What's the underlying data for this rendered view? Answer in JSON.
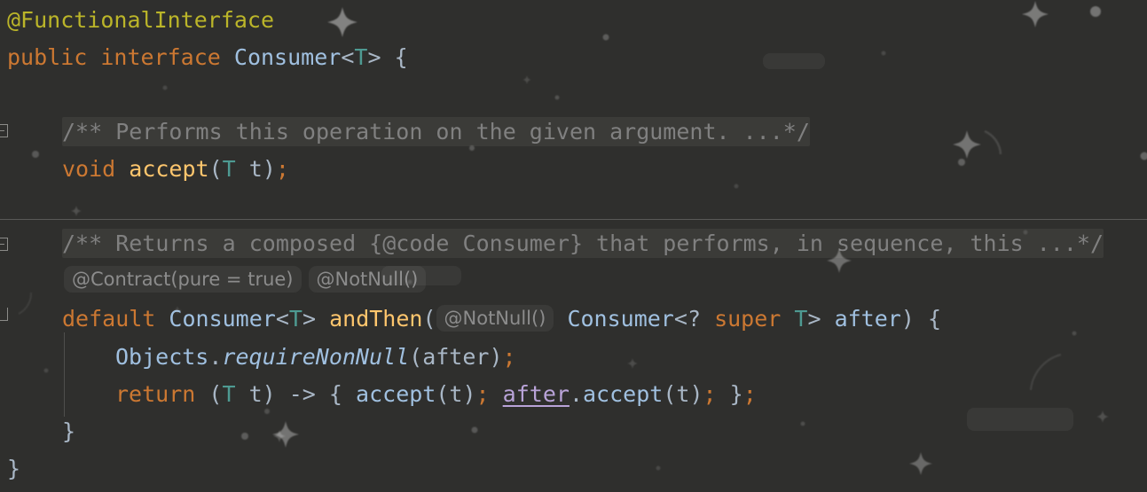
{
  "app": {
    "kind": "code-editor-snippet",
    "language": "Java",
    "theme": "darcula",
    "background_color": "#2f2f2d"
  },
  "colors": {
    "annotation": "#bbb529",
    "keyword": "#cc7832",
    "class_name": "#a0c0e0",
    "type_param": "#4e9a92",
    "method_name": "#ffc66d",
    "identifier": "#a9b7c6",
    "comment_folded": "#808080",
    "folded_background": "#3b3b38",
    "inlay_hint_text": "#8c8c8c",
    "inlay_hint_background": "#3a3a38",
    "captured_variable": "#b9a3d8",
    "separator": "#5a5a58",
    "indent_guide": "#4f4f4d",
    "gutter_icon": "#8b8b88"
  },
  "code": {
    "lines": [
      {
        "id": "line-annotation",
        "text": "@FunctionalInterface",
        "tokens": [
          {
            "t": "@FunctionalInterface",
            "c": "tok-anno"
          }
        ]
      },
      {
        "id": "line-interface-decl",
        "text": "public interface Consumer<T> {",
        "tokens": [
          {
            "t": "public",
            "c": "tok-kw"
          },
          {
            "t": " ",
            "c": "tok-punct"
          },
          {
            "t": "interface",
            "c": "tok-kw"
          },
          {
            "t": " ",
            "c": "tok-punct"
          },
          {
            "t": "Consumer",
            "c": "tok-cls"
          },
          {
            "t": "<",
            "c": "tok-punct"
          },
          {
            "t": "T",
            "c": "tok-type"
          },
          {
            "t": ">",
            "c": "tok-punct"
          },
          {
            "t": " ",
            "c": "tok-punct"
          },
          {
            "t": "{",
            "c": "tok-brace"
          }
        ]
      },
      {
        "id": "line-javadoc-accept",
        "text": "/** Performs this operation on the given argument. ...*/",
        "folded": true,
        "tokens": [
          {
            "t": "/** Performs this operation on the given argument. ...*/",
            "c": "folded"
          }
        ]
      },
      {
        "id": "line-accept",
        "text": "void accept(T t);",
        "tokens": [
          {
            "t": "void",
            "c": "tok-kw"
          },
          {
            "t": " ",
            "c": "tok-punct"
          },
          {
            "t": "accept",
            "c": "tok-method"
          },
          {
            "t": "(",
            "c": "tok-punct"
          },
          {
            "t": "T",
            "c": "tok-type"
          },
          {
            "t": " ",
            "c": "tok-punct"
          },
          {
            "t": "t",
            "c": "tok-ident"
          },
          {
            "t": ")",
            "c": "tok-punct"
          },
          {
            "t": ";",
            "c": "tok-semi"
          }
        ]
      },
      {
        "id": "line-javadoc-andthen",
        "text": "/** Returns a composed {@code Consumer} that performs, in sequence, this ...*/",
        "folded": true,
        "tokens": [
          {
            "t": "/** Returns a composed {@code Consumer} that performs, in sequence, this ...*/",
            "c": "folded"
          }
        ]
      },
      {
        "id": "line-andthen-decl",
        "text": "default Consumer<T> andThen( @NotNull() Consumer<? super T> after) {",
        "tokens": [
          {
            "t": "default",
            "c": "tok-kw"
          },
          {
            "t": " ",
            "c": "tok-punct"
          },
          {
            "t": "Consumer",
            "c": "tok-cls"
          },
          {
            "t": "<",
            "c": "tok-punct"
          },
          {
            "t": "T",
            "c": "tok-type"
          },
          {
            "t": ">",
            "c": "tok-punct"
          },
          {
            "t": " ",
            "c": "tok-punct"
          },
          {
            "t": "andThen",
            "c": "tok-method"
          },
          {
            "t": "(",
            "c": "tok-punct"
          },
          {
            "t": "@NotNull()",
            "c": "inlay"
          },
          {
            "t": " ",
            "c": "tok-punct"
          },
          {
            "t": "Consumer",
            "c": "tok-cls"
          },
          {
            "t": "<",
            "c": "tok-punct"
          },
          {
            "t": "?",
            "c": "tok-punct"
          },
          {
            "t": " ",
            "c": "tok-punct"
          },
          {
            "t": "super",
            "c": "tok-kw"
          },
          {
            "t": " ",
            "c": "tok-punct"
          },
          {
            "t": "T",
            "c": "tok-type"
          },
          {
            "t": ">",
            "c": "tok-punct"
          },
          {
            "t": " ",
            "c": "tok-punct"
          },
          {
            "t": "after",
            "c": "tok-cls"
          },
          {
            "t": ")",
            "c": "tok-punct"
          },
          {
            "t": " ",
            "c": "tok-punct"
          },
          {
            "t": "{",
            "c": "tok-brace"
          }
        ]
      },
      {
        "id": "line-requirenonnull",
        "text": "Objects.requireNonNull(after);",
        "tokens": [
          {
            "t": "Objects",
            "c": "tok-cls"
          },
          {
            "t": ".",
            "c": "tok-punct"
          },
          {
            "t": "requireNonNull",
            "c": "tok-static"
          },
          {
            "t": "(",
            "c": "tok-punct"
          },
          {
            "t": "after",
            "c": "tok-ident"
          },
          {
            "t": ")",
            "c": "tok-punct"
          },
          {
            "t": ";",
            "c": "tok-semi"
          }
        ]
      },
      {
        "id": "line-return-lambda",
        "text": "return (T t) -> { accept(t); after.accept(t); };",
        "tokens": [
          {
            "t": "return",
            "c": "tok-kw"
          },
          {
            "t": " ",
            "c": "tok-punct"
          },
          {
            "t": "(",
            "c": "tok-punct"
          },
          {
            "t": "T",
            "c": "tok-type"
          },
          {
            "t": " ",
            "c": "tok-punct"
          },
          {
            "t": "t",
            "c": "tok-ident"
          },
          {
            "t": ")",
            "c": "tok-punct"
          },
          {
            "t": " ",
            "c": "tok-punct"
          },
          {
            "t": "->",
            "c": "tok-punct"
          },
          {
            "t": " ",
            "c": "tok-punct"
          },
          {
            "t": "{",
            "c": "tok-brace"
          },
          {
            "t": " ",
            "c": "tok-punct"
          },
          {
            "t": "accept",
            "c": "tok-cls"
          },
          {
            "t": "(",
            "c": "tok-punct"
          },
          {
            "t": "t",
            "c": "tok-ident"
          },
          {
            "t": ")",
            "c": "tok-punct"
          },
          {
            "t": ";",
            "c": "tok-semi"
          },
          {
            "t": " ",
            "c": "tok-punct"
          },
          {
            "t": "after",
            "c": "tok-captured"
          },
          {
            "t": ".",
            "c": "tok-punct"
          },
          {
            "t": "accept",
            "c": "tok-cls"
          },
          {
            "t": "(",
            "c": "tok-punct"
          },
          {
            "t": "t",
            "c": "tok-ident"
          },
          {
            "t": ")",
            "c": "tok-punct"
          },
          {
            "t": ";",
            "c": "tok-semi"
          },
          {
            "t": " ",
            "c": "tok-punct"
          },
          {
            "t": "}",
            "c": "tok-brace"
          },
          {
            "t": ";",
            "c": "tok-semi"
          }
        ]
      },
      {
        "id": "line-close-method",
        "text": "}",
        "tokens": [
          {
            "t": "}",
            "c": "tok-brace"
          }
        ]
      },
      {
        "id": "line-close-interface",
        "text": "}",
        "tokens": [
          {
            "t": "}",
            "c": "tok-brace"
          }
        ]
      }
    ]
  },
  "inlay_hints": [
    {
      "id": "hint-contract",
      "text": "@Contract(pure = true)"
    },
    {
      "id": "hint-notnull-return",
      "text": "@NotNull()"
    },
    {
      "id": "hint-notnull-param",
      "text": "@NotNull()"
    }
  ],
  "gutter": {
    "fold_markers": [
      {
        "id": "fold-javadoc-accept",
        "type": "collapsed-minus"
      },
      {
        "id": "fold-javadoc-andthen",
        "type": "collapsed-minus"
      },
      {
        "id": "fold-method-andthen",
        "type": "region-end"
      }
    ]
  },
  "decorations": {
    "separator_after_line": "line-accept",
    "indent_guide_column": 4
  }
}
